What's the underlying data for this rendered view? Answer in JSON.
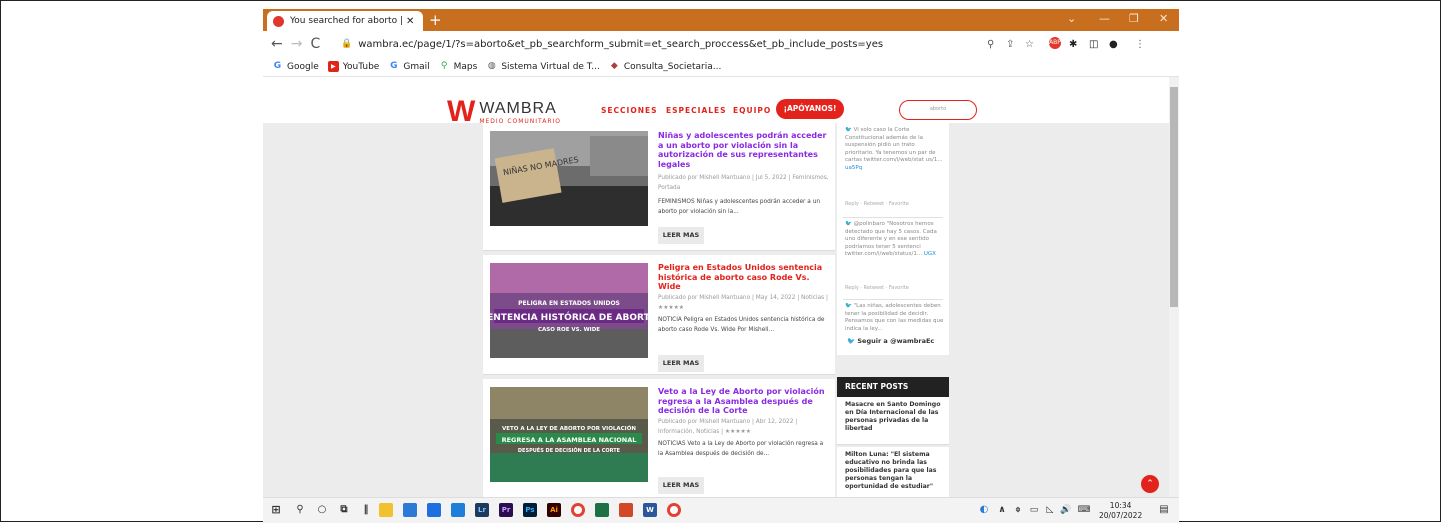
{
  "browser": {
    "tab_title": "You searched for aborto | Wamb",
    "tab_close": "✕",
    "new_tab": "+",
    "url": "wambra.ec/page/1/?s=aborto&et_pb_searchform_submit=et_search_proccess&et_pb_include_posts=yes",
    "bookmarks": [
      {
        "label": "Google",
        "icon": "google-g-icon"
      },
      {
        "label": "YouTube",
        "icon": "youtube-icon"
      },
      {
        "label": "Gmail",
        "icon": "google-g-icon"
      },
      {
        "label": "Maps",
        "icon": "maps-pin-icon"
      },
      {
        "label": "Sistema Virtual de T...",
        "icon": "globe-icon"
      },
      {
        "label": "Consulta_Societaria...",
        "icon": "diamond-icon"
      }
    ]
  },
  "site": {
    "logo_name": "WAMBRA",
    "logo_sub": "MEDIO COMUNITARIO",
    "menu": [
      "SECCIONES",
      "ESPECIALES",
      "EQUIPO"
    ],
    "cta": "¡APÓYANOS!",
    "search_value": "aborto",
    "accent": "#e3231b"
  },
  "posts": [
    {
      "title": "Niñas y adolescentes podrán acceder a un aborto por violación sin la autorización de sus representantes legales",
      "meta": "Publicado por Mishell Mantuano | Jul 5, 2022 | Feminismos, Portada",
      "excerpt": "FEMINISMOS Niñas y adolescentes podrán acceder a un aborto por violación sin la...",
      "image_text": "NIÑAS NO MADRES",
      "button": "LEER MAS",
      "title_color": "#8a2be2"
    },
    {
      "title": "Peligra en Estados Unidos sentencia histórica de aborto caso Rode Vs. Wide",
      "meta": "Publicado por Mishell Mantuano | May 14, 2022 | Noticias | ★★★★★",
      "excerpt": "NOTICIA Peligra en Estados Unidos sentencia histórica de aborto caso Rode Vs. Wide Por Mishell...",
      "image_lines": [
        "PELIGRA EN ESTADOS UNIDOS",
        "SENTENCIA HISTÓRICA DE ABORTO",
        "CASO ROE VS. WIDE"
      ],
      "button": "LEER MAS",
      "title_color": "#e3231b"
    },
    {
      "title": "Veto a la Ley de Aborto por violación regresa a la Asamblea después de decisión de la Corte",
      "meta": "Publicado por Mishell Mantuano | Abr 12, 2022 | Información, Noticias | ★★★★★",
      "excerpt": "NOTICIAS Veto a la Ley de Aborto por violación regresa a la Asamblea después de decisión de...",
      "image_lines": [
        "VETO A LA LEY DE ABORTO POR VIOLACIÓN",
        "REGRESA A LA ASAMBLEA NACIONAL",
        "DESPUÉS DE DECISIÓN DE LA CORTE"
      ],
      "button": "LEER MAS",
      "title_color": "#8a2be2"
    }
  ],
  "tweets": [
    {
      "text": "Vi solo caso la Corte Constitucional además de la suspensión pidió un trato prioritario. Ya tenemos un par de cartas twitter.com/i/web/stat us/1...",
      "link": "ua5Pq",
      "actions": "Reply · Retweet · Favorite"
    },
    {
      "text": "@polinbaro \"Nosotros hemos detectado que hay 5 casos. Cada uno diferente y en ese sentido podríamos tener 5 sentenci twitter.com/i/web/status/1...",
      "link": "UGX",
      "actions": "Reply · Retweet · Favorite"
    },
    {
      "text": "\"Las niñas, adolescentes deben tener la posibilidad de decidir. Pensamos que con las medidas que indica la ley...",
      "link": "",
      "actions": ""
    }
  ],
  "follow": "Seguir a @wambraEc",
  "recent_posts_title": "RECENT POSTS",
  "recent_posts": [
    "Masacre en Santo Domingo en Día Internacional de las personas privadas de la libertad",
    "Milton Luna: \"El sistema educativo no brinda las posibilidades para que las personas tengan la oportunidad de estudiar\""
  ],
  "taskbar": {
    "time": "10:34",
    "date": "20/07/2022",
    "apps": [
      "Lr",
      "Pr",
      "Ps",
      "Ai",
      "W"
    ]
  }
}
